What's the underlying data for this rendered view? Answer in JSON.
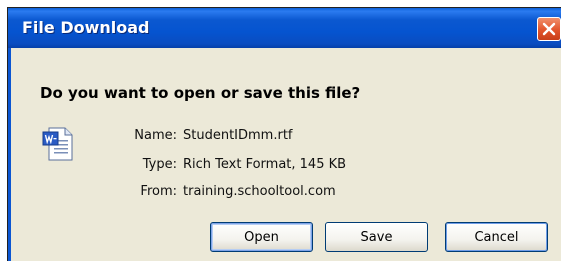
{
  "dialog": {
    "title": "File Download",
    "question": "Do you want to open or save this file?"
  },
  "file": {
    "icon": "word-document-icon",
    "fields": [
      {
        "label": "Name:",
        "value": "StudentIDmm.rtf"
      },
      {
        "label": "Type:",
        "value": "Rich Text Format, 145 KB"
      },
      {
        "label": "From:",
        "value": "training.schooltool.com"
      }
    ]
  },
  "buttons": {
    "open": "Open",
    "save": "Save",
    "cancel": "Cancel"
  },
  "colors": {
    "titlebar": "#0554d0",
    "dialog_bg": "#ece9d8",
    "close_button": "#e2542c",
    "button_border": "#003c74"
  }
}
